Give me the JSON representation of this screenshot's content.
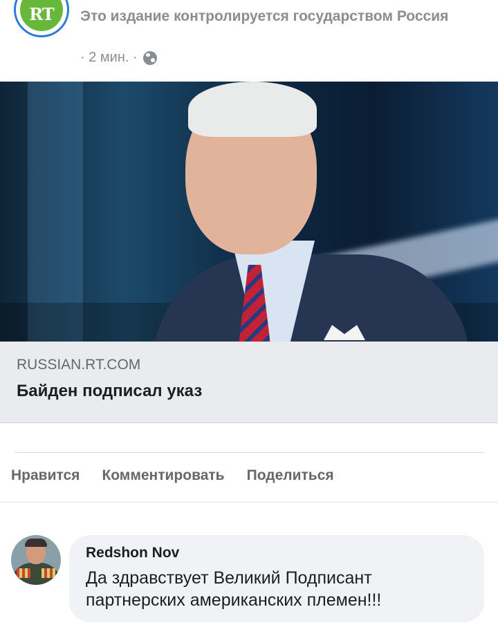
{
  "post": {
    "state_note": "Это издание контролируется государством Россия",
    "time": "· 2 мин. ·",
    "avatar_text": "RT"
  },
  "link": {
    "domain": "RUSSIAN.RT.COM",
    "title": "Байден подписал указ"
  },
  "actions": {
    "like": "Нравится",
    "comment": "Комментировать",
    "share": "Поделиться"
  },
  "comment": {
    "author": "Redshon Nov",
    "text": "Да здравствует Великий Подписант партнерских американских племен!!!"
  }
}
